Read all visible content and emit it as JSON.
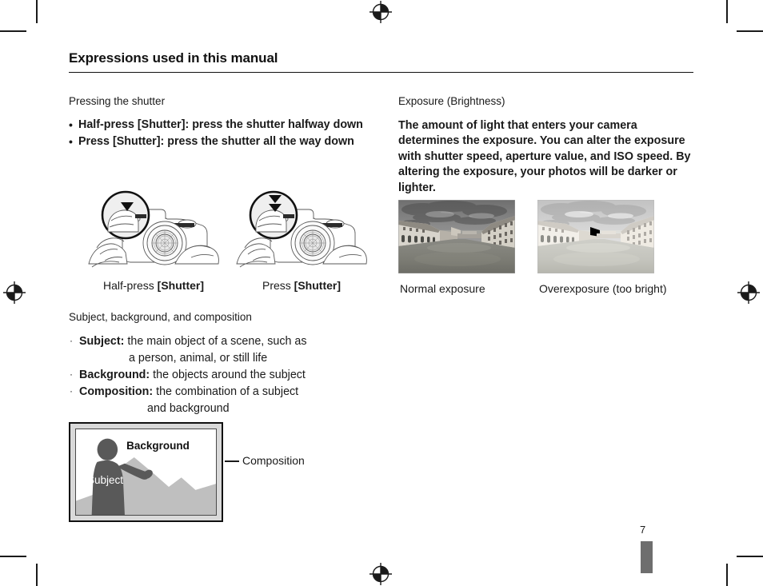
{
  "document": {
    "heading": "Expressions used in this manual",
    "page_number": "7"
  },
  "left_column": {
    "section1": {
      "subhead": "Pressing the shutter",
      "bullets": [
        {
          "bullet": "•",
          "lead": "Half-press ",
          "term": "[Shutter]",
          "rest": ": press the shutter halfway down"
        },
        {
          "bullet": "•",
          "lead": "Press ",
          "term": "[Shutter]",
          "rest": ": press the shutter all the way down"
        }
      ],
      "figures": [
        {
          "caption_plain": "Half-press ",
          "caption_bold": "[Shutter]",
          "alt": "hands-holding-camera-half-press"
        },
        {
          "caption_plain": "Press ",
          "caption_bold": "[Shutter]",
          "alt": "hands-holding-camera-full-press"
        }
      ]
    },
    "section2": {
      "subhead": "Subject, background, and composition",
      "bullets": [
        {
          "bullet": "·",
          "term": "Subject:",
          "text": "the main object of a scene, such as",
          "cont": "a person, animal, or still life"
        },
        {
          "bullet": "·",
          "term": "Background:",
          "text": "the objects around the subject",
          "cont": ""
        },
        {
          "bullet": "·",
          "term": "Composition:",
          "text": "the combination of a subject",
          "cont": "and background"
        }
      ],
      "diagram": {
        "label_background": "Background",
        "label_subject": "Subject",
        "label_composition": "Composition"
      }
    }
  },
  "right_column": {
    "subhead": "Exposure (Brightness)",
    "paragraph": "The amount of light that enters your camera determines the exposure. You can alter the exposure with shutter speed, aperture value, and ISO speed. By altering the exposure, your photos will be darker or lighter.",
    "photos": [
      {
        "caption": "Normal exposure",
        "alt": "river-scene-normal-exposure"
      },
      {
        "caption": "Overexposure (too bright)",
        "alt": "river-scene-overexposed"
      }
    ]
  },
  "print_marks": {
    "registration_icon": "registration-target-icon",
    "crop_icon": "crop-mark"
  },
  "colors": {
    "ink": "#1a1a1a",
    "rule": "#111111",
    "diagram_frame": "#d9d9d9",
    "silhouette": "#595959",
    "mountain": "#bfbfbf",
    "page_tab": "#6e6e6e"
  }
}
